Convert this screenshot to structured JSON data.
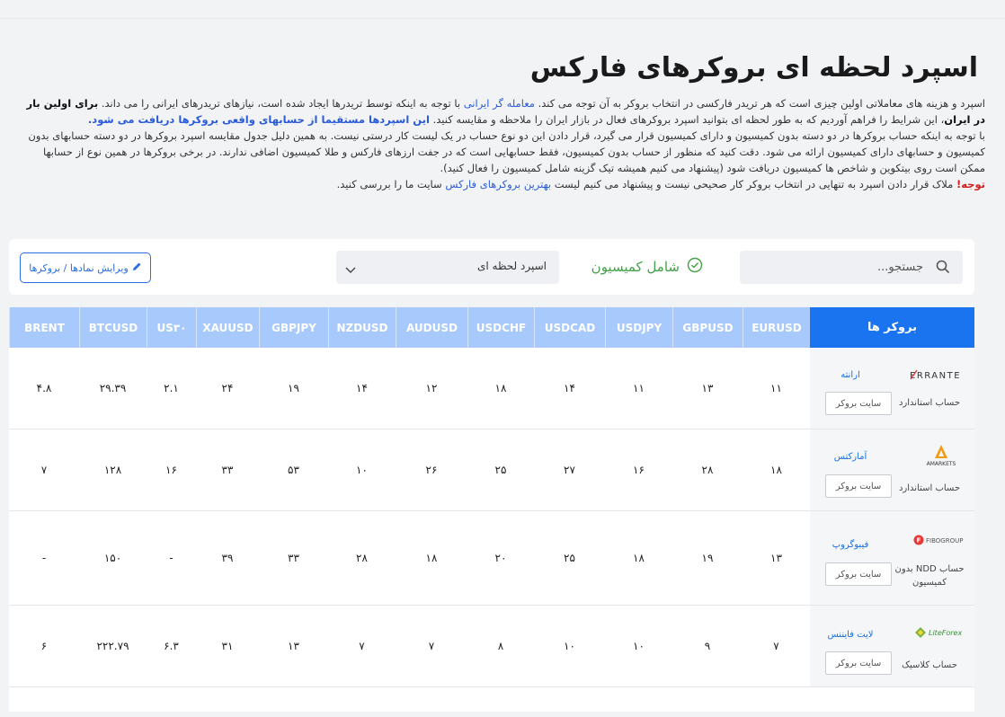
{
  "page": {
    "title": "اسپرد لحظه ای بروکرهای فارکس",
    "intro": {
      "p1_a": "اسپرد و هزینه های معاملاتی اولین چیزی است که هر تریدر فارکسی در انتخاب بروکر به آن توجه می کند.",
      "p1_link": "معامله گر ایرانی",
      "p1_b": "با توجه به اینکه توسط تریدرها ایجاد شده است، نیازهای تریدرهای ایرانی را می داند.",
      "p1_bold": "برای اولین بار در ایران",
      "p1_c": "، این شرایط را فراهم آوردیم که به طور لحظه ای بتوانید اسپرد بروکرهای فعال در بازار ایران را ملاحظه و مقایسه کنید.",
      "p1_link2": "این اسپردها مستقیما از حسابهای واقعی بروکرها دریافت می شود.",
      "p2": "با توجه به اینکه حساب بروکرها در دو دسته بدون کمیسیون و دارای کمیسیون قرار می گیرد، قرار دادن این دو نوع حساب در یک لیست کار درستی نیست. به همین دلیل جدول مقایسه اسپرد بروکرها در دو دسته حسابهای بدون کمیسیون و حسابهای دارای کمیسیون ارائه می شود. دقت کنید که منظور از حساب بدون کمیسیون، فقط حسابهایی است که در جفت ارزهای فارکس و طلا کمیسیون اضافی ندارند. در برخی بروکرها در همین نوع از حسابها ممکن است روی بیتکوین و شاخص ها کمیسیون دریافت شود (پیشنهاد می کنیم همیشه تیک گزینه شامل کمیسیون را فعال کنید).",
      "p3_note": "توجه!",
      "p3_a": "ملاک قرار دادن اسپرد به تنهایی در انتخاب بروکر کار صحیحی نیست و پیشنهاد می کنیم لیست",
      "p3_link": "بهترین بروکرهای فارکس",
      "p3_b": "سایت ما را بررسی کنید."
    }
  },
  "toolbar": {
    "search_placeholder": "جستجو...",
    "commission_label": "شامل کمیسیون",
    "spread_select_value": "اسپرد لحظه ای",
    "edit_button_label": "ویرایش نمادها / بروکرها"
  },
  "table": {
    "brokers_header": "بروکر ها",
    "columns": [
      "EURUSD",
      "GBPUSD",
      "USDJPY",
      "USDCAD",
      "USDCHF",
      "AUDUSD",
      "NZDUSD",
      "GBPJPY",
      "XAUUSD",
      "US۳۰",
      "BTCUSD",
      "BRENT"
    ],
    "site_button_label": "سایت بروکر",
    "rows": [
      {
        "logo": "ERRANTE",
        "name": "ارانته",
        "account": "حساب استاندارد",
        "values": [
          "۱۱",
          "۱۳",
          "۱۱",
          "۱۴",
          "۱۸",
          "۱۲",
          "۱۴",
          "۱۹",
          "۲۴",
          "۲.۱",
          "۲۹.۳۹",
          "۴.۸"
        ]
      },
      {
        "logo": "AMARKETS",
        "name": "آمارکتس",
        "account": "حساب استاندارد",
        "values": [
          "۱۸",
          "۲۸",
          "۱۶",
          "۲۷",
          "۲۵",
          "۲۶",
          "۱۰",
          "۵۳",
          "۳۳",
          "۱۶",
          "۱۲۸",
          "۷"
        ]
      },
      {
        "logo": "FIBOGROUP",
        "name": "فیبوگروپ",
        "account": "حساب NDD بدون کمیسیون",
        "values": [
          "۱۳",
          "۱۹",
          "۱۸",
          "۲۵",
          "۲۰",
          "۱۸",
          "۲۸",
          "۳۳",
          "۳۹",
          "-",
          "۱۵۰",
          "-"
        ]
      },
      {
        "logo": "LiteForex",
        "name": "لایت فایننس",
        "account": "حساب کلاسیک",
        "values": [
          "۷",
          "۹",
          "۱۰",
          "۱۰",
          "۸",
          "۷",
          "۷",
          "۱۳",
          "۳۱",
          "۶.۳",
          "۲۲۲.۷۹",
          "۶"
        ]
      }
    ]
  },
  "colors": {
    "header_blue": "#1a73ef",
    "header_light": "#a7c9fb",
    "link": "#2a5bd7",
    "commission_green": "#43a047",
    "warning_red": "#d21f1f"
  },
  "icons": [
    "search-icon",
    "check-circle-icon",
    "chevron-down-icon",
    "pencil-icon"
  ]
}
